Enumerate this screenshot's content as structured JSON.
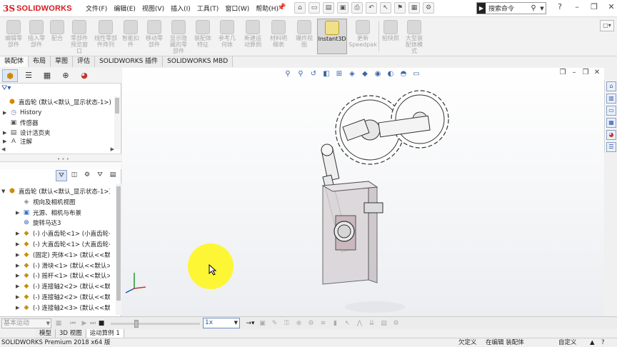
{
  "app": {
    "logo_ds": "3S",
    "logo_text": "SOLIDWORKS"
  },
  "menu": [
    "文件(F)",
    "编辑(E)",
    "视图(V)",
    "插入(I)",
    "工具(T)",
    "窗口(W)",
    "帮助(H)"
  ],
  "search": {
    "placeholder": "搜索命令"
  },
  "commands": [
    {
      "label": "编辑零\n部件"
    },
    {
      "label": "插入零\n部件"
    },
    {
      "label": "配合"
    },
    {
      "label": "零部件\n预览窗\n口"
    },
    {
      "label": "线性零部\n件阵列"
    },
    {
      "label": "智能扣\n件"
    },
    {
      "label": "移动零\n部件"
    },
    {
      "label": "显示隐\n藏的零\n部件"
    },
    {
      "label": "装配体\n特征"
    },
    {
      "label": "参考几\n何体"
    },
    {
      "label": "新建运\n动算例"
    },
    {
      "label": "材料明\n细表"
    },
    {
      "label": "爆炸视\n图"
    },
    {
      "label": "Instant3D"
    },
    {
      "label": "更新\nSpeedpak"
    },
    {
      "label": "拍快照"
    },
    {
      "label": "大型装\n配体模\n式"
    }
  ],
  "tabs": [
    "装配体",
    "布局",
    "草图",
    "评估",
    "SOLIDWORKS 插件",
    "SOLIDWORKS MBD"
  ],
  "upper_tree": [
    {
      "label": "直齿轮 (默认<默认_显示状态-1>)",
      "icon": "assembly-icon",
      "expand": ""
    },
    {
      "label": "History",
      "icon": "history-icon",
      "expand": "▶"
    },
    {
      "label": "传感器",
      "icon": "sensor-icon",
      "expand": ""
    },
    {
      "label": "设计活页夹",
      "icon": "binder-icon",
      "expand": "▶"
    },
    {
      "label": "注解",
      "icon": "annotation-icon",
      "expand": "▶"
    }
  ],
  "lower_tree": [
    {
      "label": "直齿轮 (默认<默认_显示状态-1>)",
      "icon": "assembly-icon",
      "expand": "▼",
      "indent": 0
    },
    {
      "label": "视向及相机视图",
      "icon": "camera-icon",
      "expand": "",
      "indent": 1
    },
    {
      "label": "光源、相机与布景",
      "icon": "light-icon",
      "expand": "▶",
      "indent": 1
    },
    {
      "label": "旋转马达3",
      "icon": "motor-icon",
      "expand": "",
      "indent": 1
    },
    {
      "label": "(-) 小直齿轮<1> (小直齿轮<D",
      "icon": "part-icon",
      "expand": "▶",
      "indent": 1
    },
    {
      "label": "(-) 大直齿轮<1> (大直齿轮<D",
      "icon": "part-icon",
      "expand": "▶",
      "indent": 1
    },
    {
      "label": "(固定) 壳体<1> (默认<<默认",
      "icon": "part-icon",
      "expand": "▶",
      "indent": 1
    },
    {
      "label": "(-) 滑块<1> (默认<<默认>_显",
      "icon": "part-icon",
      "expand": "▶",
      "indent": 1
    },
    {
      "label": "(-) 摇杆<1> (默认<<默认>_显",
      "icon": "part-icon",
      "expand": "▶",
      "indent": 1
    },
    {
      "label": "(-) 连接轴2<2> (默认<<默认",
      "icon": "part-icon",
      "expand": "▶",
      "indent": 1
    },
    {
      "label": "(-) 连接轴2<2> (默认<<默认>",
      "icon": "part-icon",
      "expand": "▶",
      "indent": 1
    },
    {
      "label": "(-) 连接轴2<3> (默认<<默认",
      "icon": "part-icon",
      "expand": "▶",
      "indent": 1
    }
  ],
  "motion": {
    "study_type": "基本运动",
    "speed": "1x"
  },
  "bottom_tabs": [
    "模型",
    "3D 视图",
    "运动算例 1"
  ],
  "status": {
    "left": "SOLIDWORKS Premium 2018 x64 版",
    "custom": "欠定义",
    "editing": "在编辑 装配体",
    "custom2": "自定义"
  },
  "colors": {
    "brand": "#d71920",
    "highlight": "#fdf52a",
    "accent": "#2a55a8"
  }
}
